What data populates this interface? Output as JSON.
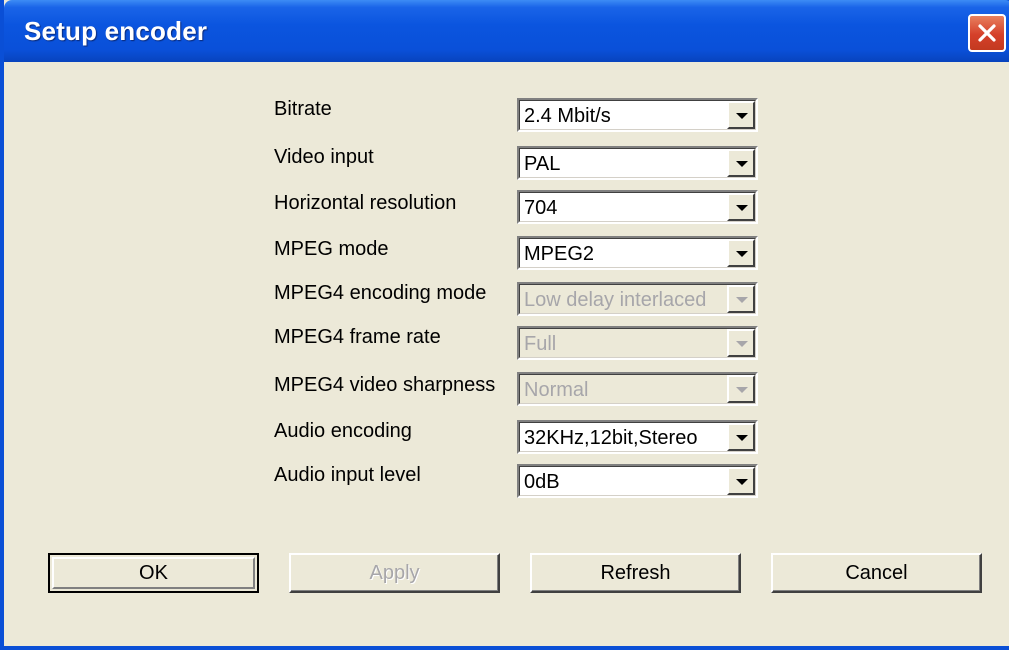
{
  "window": {
    "title": "Setup encoder"
  },
  "fields": [
    {
      "label": "Bitrate",
      "value": "2.4 Mbit/s",
      "enabled": true
    },
    {
      "label": "Video input",
      "value": "PAL",
      "enabled": true
    },
    {
      "label": "Horizontal resolution",
      "value": "704",
      "enabled": true
    },
    {
      "label": "MPEG mode",
      "value": "MPEG2",
      "enabled": true
    },
    {
      "label": "MPEG4 encoding mode",
      "value": "Low delay interlaced",
      "enabled": false
    },
    {
      "label": "MPEG4 frame rate",
      "value": "Full",
      "enabled": false
    },
    {
      "label": "MPEG4 video sharpness",
      "value": "Normal",
      "enabled": false
    },
    {
      "label": "Audio encoding",
      "value": "32KHz,12bit,Stereo",
      "enabled": true
    },
    {
      "label": "Audio input level",
      "value": "0dB",
      "enabled": true
    }
  ],
  "buttons": {
    "ok": "OK",
    "apply": "Apply",
    "refresh": "Refresh",
    "cancel": "Cancel"
  },
  "icons": {
    "close": "close-icon",
    "dropdown": "chevron-down-icon"
  },
  "colors": {
    "titlebar": "#0a50d9",
    "close": "#d5402a",
    "face": "#ece9d8",
    "disabled_text": "#a7a6aa"
  }
}
